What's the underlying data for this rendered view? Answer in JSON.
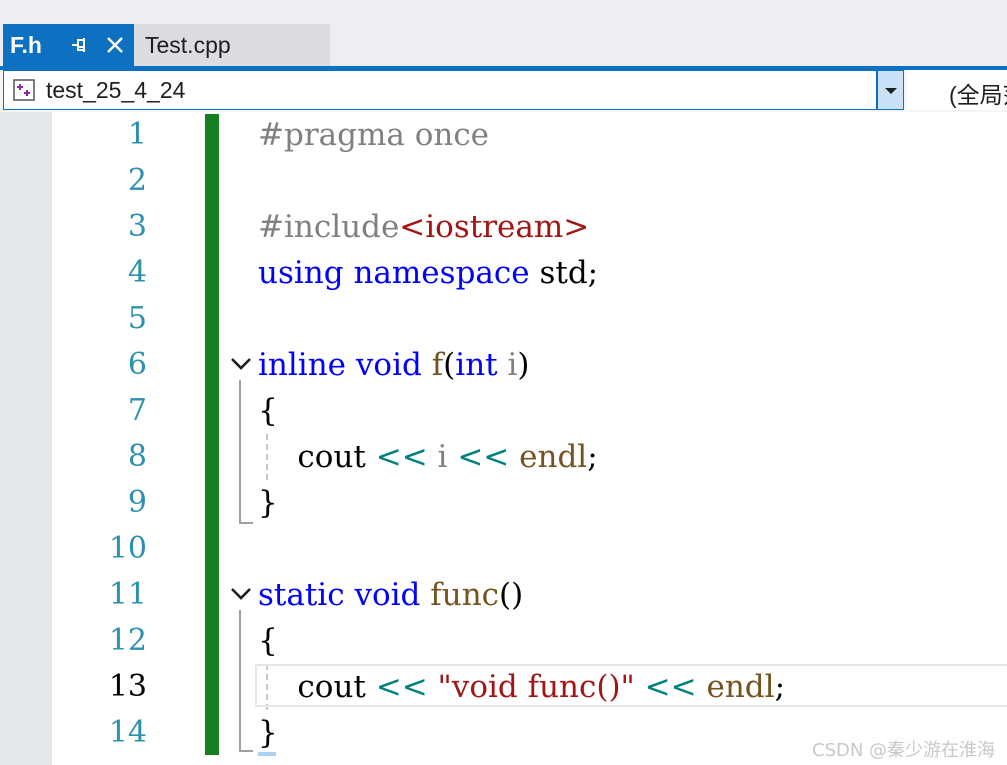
{
  "tabs": [
    {
      "label": "F.h",
      "active": true
    },
    {
      "label": "Test.cpp",
      "active": false
    }
  ],
  "navbar": {
    "scope": "test_25_4_24",
    "members": "(全局范围)"
  },
  "editor": {
    "current_line": 13,
    "line_numbers": [
      "1",
      "2",
      "3",
      "4",
      "5",
      "6",
      "7",
      "8",
      "9",
      "10",
      "11",
      "12",
      "13",
      "14"
    ],
    "code": {
      "l1": {
        "text": "#pragma once"
      },
      "l3": {
        "directive": "#include",
        "header": "<iostream>"
      },
      "l4": {
        "kw1": "using",
        "kw2": "namespace",
        "rest": " std;"
      },
      "l6": {
        "kw1": "inline",
        "kw2": "void",
        "fn": "f",
        "open": "(",
        "type": "int",
        "param": "i",
        "close": ")"
      },
      "l7": {
        "text": "{"
      },
      "l8": {
        "id1": "cout",
        "op1": "<<",
        "id2": "i",
        "op2": "<<",
        "id3": "endl",
        "semi": ";"
      },
      "l9": {
        "text": "}"
      },
      "l11": {
        "kw1": "static",
        "kw2": "void",
        "fn": "func",
        "parens": "()"
      },
      "l12": {
        "text": "{"
      },
      "l13": {
        "id1": "cout",
        "op1": "<<",
        "str": "\"void func()\"",
        "op2": "<<",
        "id2": "endl",
        "semi": ";"
      },
      "l14": {
        "text": "}"
      }
    }
  },
  "watermark": "CSDN @秦少游在淮海",
  "colors": {
    "accent": "#0e70c0",
    "keyword": "#0000ff",
    "preprocessor": "#808080",
    "string": "#a31515",
    "operator": "#008080",
    "function": "#74531f",
    "change_bar": "#157f1f",
    "line_number": "#2b91af"
  },
  "icons": [
    "pin-icon",
    "close-icon",
    "class-scope-icon",
    "chevron-down-icon",
    "fold-collapse-icon"
  ]
}
